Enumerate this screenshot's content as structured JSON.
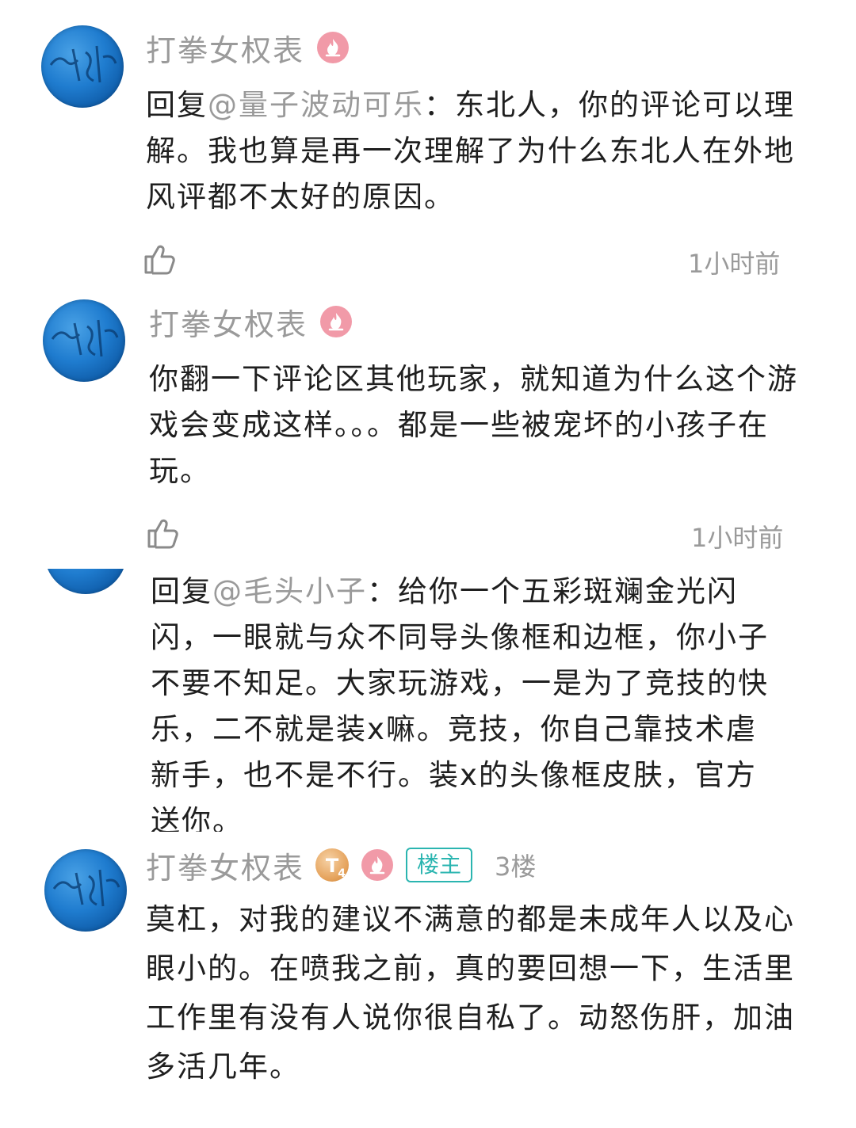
{
  "comments": [
    {
      "user": "打拳女权表",
      "reply_prefix": "回复",
      "mention": "@量子波动可乐",
      "text": "：东北人，你的评论可以理解。我也算是再一次理解了为什么东北人在外地风评都不太好的原因。",
      "time": "1小时前"
    },
    {
      "user": "打拳女权表",
      "text": "你翻一下评论区其他玩家，就知道为什么这个游戏会变成这样。。。都是一些被宠坏的小孩子在玩。",
      "time": "1小时前"
    },
    {
      "reply_prefix": "回复",
      "mention": "@毛头小子",
      "text": "：给你一个五彩斑斓金光闪闪，一眼就与众不同导头像框和边框，你小子不要不知足。大家玩游戏，一是为了竞技的快乐，二不就是装x嘛。竞技，你自己靠技术虐新手，也不是不行。装x的头像框皮肤，官方送你。"
    },
    {
      "user": "打拳女权表",
      "badge_t": "T",
      "badge_t_sub": "4",
      "owner_tag": "楼主",
      "floor": "3楼",
      "text": "莫杠，对我的建议不满意的都是未成年人以及心眼小的。在喷我之前，真的要回想一下，生活里工作里有没有人说你很自私了。动怒伤肝，加油多活几年。"
    }
  ],
  "colors": {
    "name": "#9a9a9a",
    "text": "#1f1f1f",
    "owner_tag": "#2bb5b0",
    "fire_badge": "#f19aa8",
    "avatar": "#1f7ccf"
  }
}
